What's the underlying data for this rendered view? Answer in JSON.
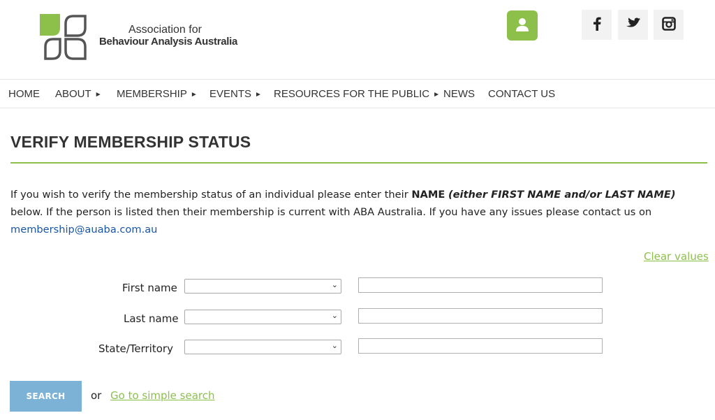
{
  "brand": {
    "name_line1": "Association for",
    "name_line2": "Behaviour Analysis Australia"
  },
  "colors": {
    "accent_green": "#8cc04b",
    "search_button_blue": "#7cb2d6",
    "link_blue": "#1a55a3"
  },
  "header": {
    "user_icon": "user-icon",
    "social": [
      "facebook-icon",
      "twitter-icon",
      "instagram-icon"
    ]
  },
  "nav": {
    "items": [
      {
        "label": "HOME"
      },
      {
        "label": "ABOUT",
        "arrow": "►"
      },
      {
        "label": "MEMBERSHIP",
        "arrow": "►"
      },
      {
        "label": "EVENTS",
        "arrow": "►"
      },
      {
        "label": "RESOURCES FOR THE PUBLIC",
        "arrow": "►"
      },
      {
        "label": "NEWS"
      },
      {
        "label": "CONTACT US"
      }
    ]
  },
  "page": {
    "title": "VERIFY MEMBERSHIP STATUS",
    "intro_part1": "If you wish to verify the membership status of an individual please enter their ",
    "intro_bold": "NAME",
    "intro_emph": "(either FIRST NAME and/or LAST NAME)",
    "intro_part2": " below. If the person is listed then their membership is current with ABA Australia. If you have any issues please contact us on ",
    "email": "membership@auaba.com.au",
    "clear_values": "Clear values"
  },
  "form": {
    "first_name_label": "First name",
    "last_name_label": "Last name",
    "state_label": "State/Territory",
    "first_name_select": "",
    "last_name_select": "",
    "state_select": "",
    "first_name_value": "",
    "last_name_value": "",
    "state_value": "",
    "search_label": "SEARCH",
    "or_text": "or",
    "simple_search_label": "Go to simple search"
  }
}
